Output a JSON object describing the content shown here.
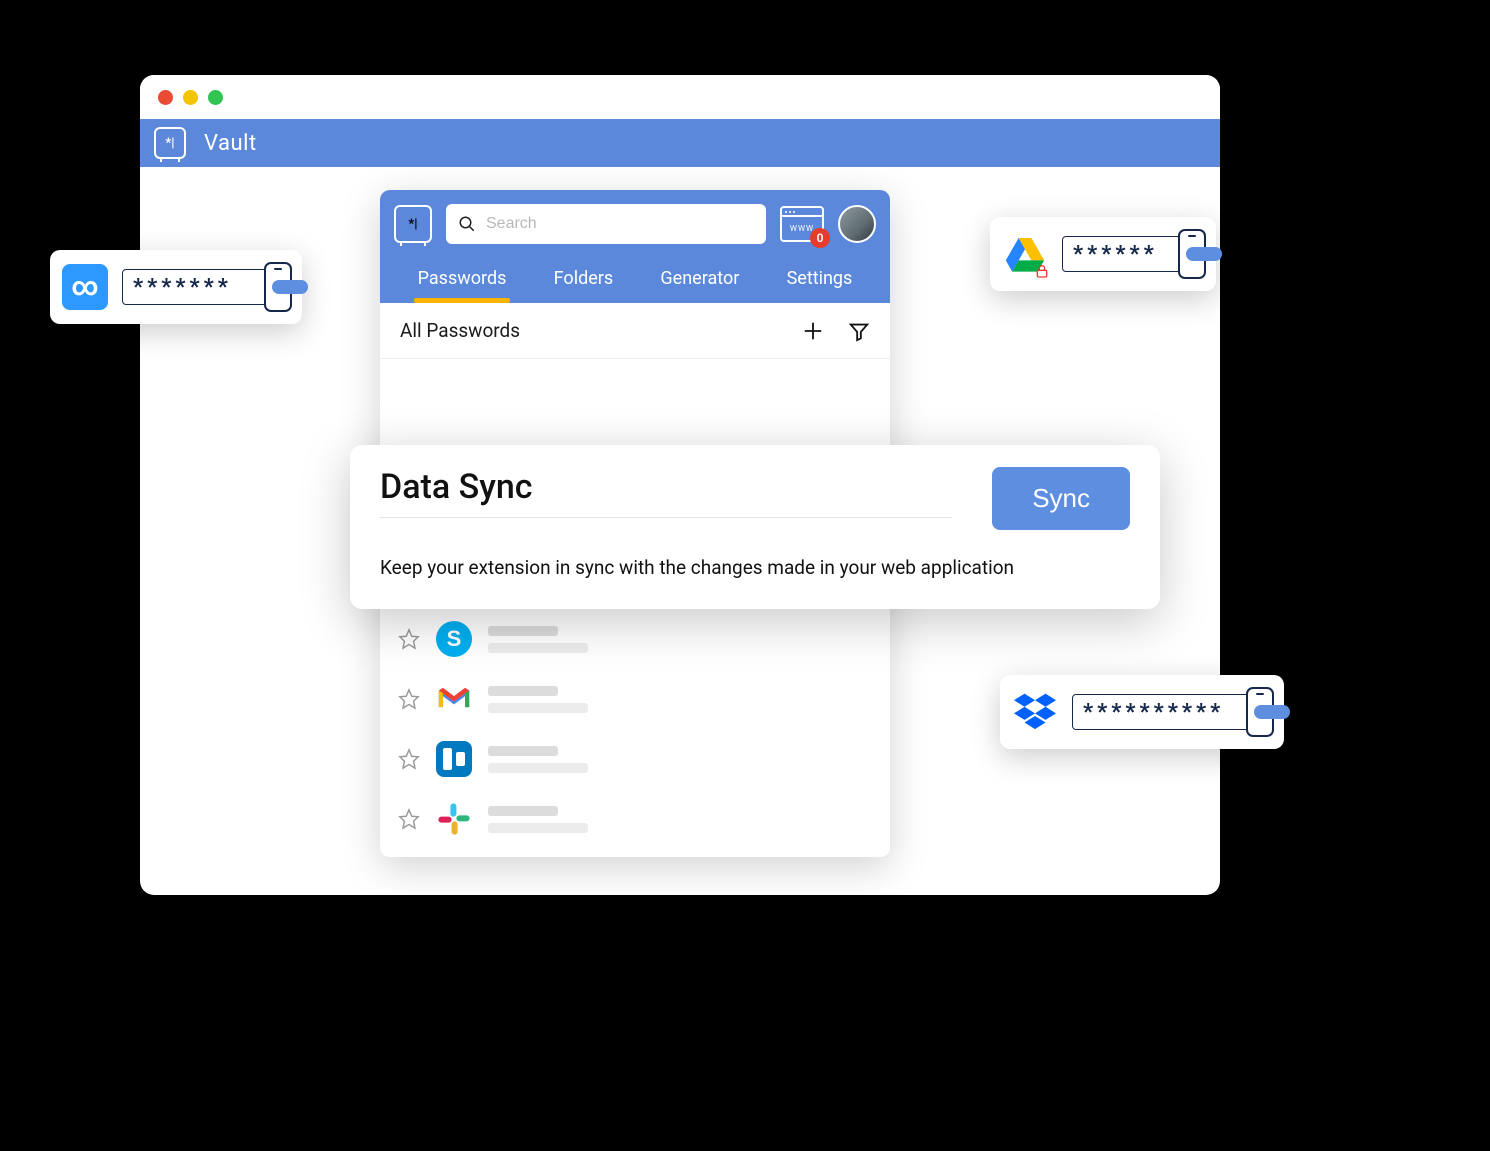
{
  "app": {
    "title": "Vault",
    "vault_glyph": "*|"
  },
  "search": {
    "placeholder": "Search"
  },
  "www": {
    "label": "WWW",
    "badge": "0"
  },
  "tabs": [
    {
      "label": "Passwords",
      "active": true
    },
    {
      "label": "Folders",
      "active": false
    },
    {
      "label": "Generator",
      "active": false
    },
    {
      "label": "Settings",
      "active": false
    }
  ],
  "list": {
    "title": "All Passwords"
  },
  "items": [
    {
      "icon": "instagram"
    },
    {
      "icon": "skype"
    },
    {
      "icon": "gmail"
    },
    {
      "icon": "trello"
    },
    {
      "icon": "slack"
    }
  ],
  "sync": {
    "title": "Data Sync",
    "button": "Sync",
    "desc": "Keep your extension in sync with the changes made in your web application"
  },
  "pills": {
    "p1": {
      "icon": "infinity",
      "mask": "*******"
    },
    "p2": {
      "icon": "drive-locked",
      "mask": "******"
    },
    "p3": {
      "icon": "dropbox",
      "mask": "**********"
    }
  },
  "colors": {
    "primary": "#5b88da",
    "accent": "#f8b400",
    "danger": "#e63c2e"
  }
}
